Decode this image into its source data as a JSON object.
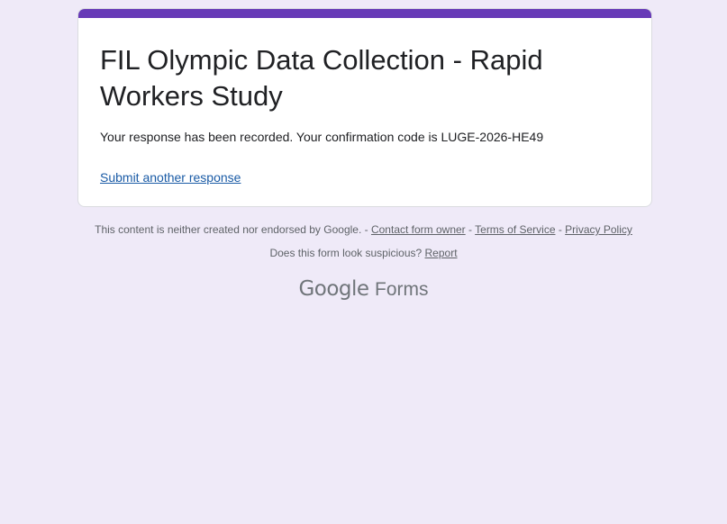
{
  "form": {
    "title": "FIL Olympic Data Collection - Rapid Workers Study",
    "confirmation": "Your response has been recorded. Your confirmation code is LUGE-2026-HE49",
    "submit_another": "Submit another response"
  },
  "footer": {
    "disclaimer": "This content is neither created nor endorsed by Google. - ",
    "contact": "Contact form owner",
    "sep1": " - ",
    "terms": "Terms of Service",
    "sep2": " - ",
    "privacy": "Privacy Policy",
    "suspicious": "Does this form look suspicious? ",
    "report": "Report"
  },
  "brand": {
    "google": "Google",
    "product": "Forms"
  },
  "colors": {
    "accent": "#673ab7",
    "background": "#efeaf8",
    "link": "#1a5ba6"
  }
}
